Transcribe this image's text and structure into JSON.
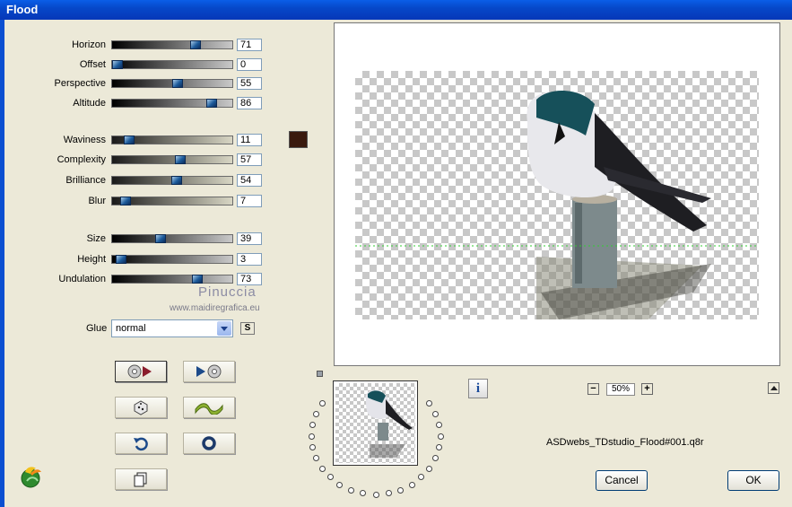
{
  "window": {
    "title": "Flood"
  },
  "sliders_group1": [
    {
      "label": "Horizon",
      "value": "71",
      "fraction": 0.71
    },
    {
      "label": "Offset",
      "value": "0",
      "fraction": 0.0
    },
    {
      "label": "Perspective",
      "value": "55",
      "fraction": 0.55
    },
    {
      "label": "Altitude",
      "value": "86",
      "fraction": 0.86
    }
  ],
  "sliders_group2": [
    {
      "label": "Waviness",
      "value": "11",
      "fraction": 0.11
    },
    {
      "label": "Complexity",
      "value": "57",
      "fraction": 0.57
    },
    {
      "label": "Brilliance",
      "value": "54",
      "fraction": 0.54
    },
    {
      "label": "Blur",
      "value": "7",
      "fraction": 0.07
    }
  ],
  "sliders_group3": [
    {
      "label": "Size",
      "value": "39",
      "fraction": 0.39
    },
    {
      "label": "Height",
      "value": "3",
      "fraction": 0.03
    },
    {
      "label": "Undulation",
      "value": "73",
      "fraction": 0.73
    }
  ],
  "colors": {
    "flood_color": "#3a1a0e",
    "titlebar": "#0648c9"
  },
  "watermark": {
    "name": "Pinuccia",
    "site": "www.maidiregrafica.eu"
  },
  "glue": {
    "label": "Glue",
    "value": "normal",
    "s_button": "S"
  },
  "preview": {
    "zoom": "50%"
  },
  "preset": {
    "filename": "ASDwebs_TDstudio_Flood#001.q8r"
  },
  "buttons": {
    "cancel": "Cancel",
    "ok": "OK"
  },
  "icons": [
    "apply-preview-icon",
    "play-preview-icon",
    "dice-random-icon",
    "wave-icon",
    "undo-icon",
    "reset-circle-icon",
    "copy-icon",
    "info-icon",
    "zoom-minus-icon",
    "zoom-plus-icon",
    "scroll-up-icon",
    "app-logo-icon"
  ]
}
